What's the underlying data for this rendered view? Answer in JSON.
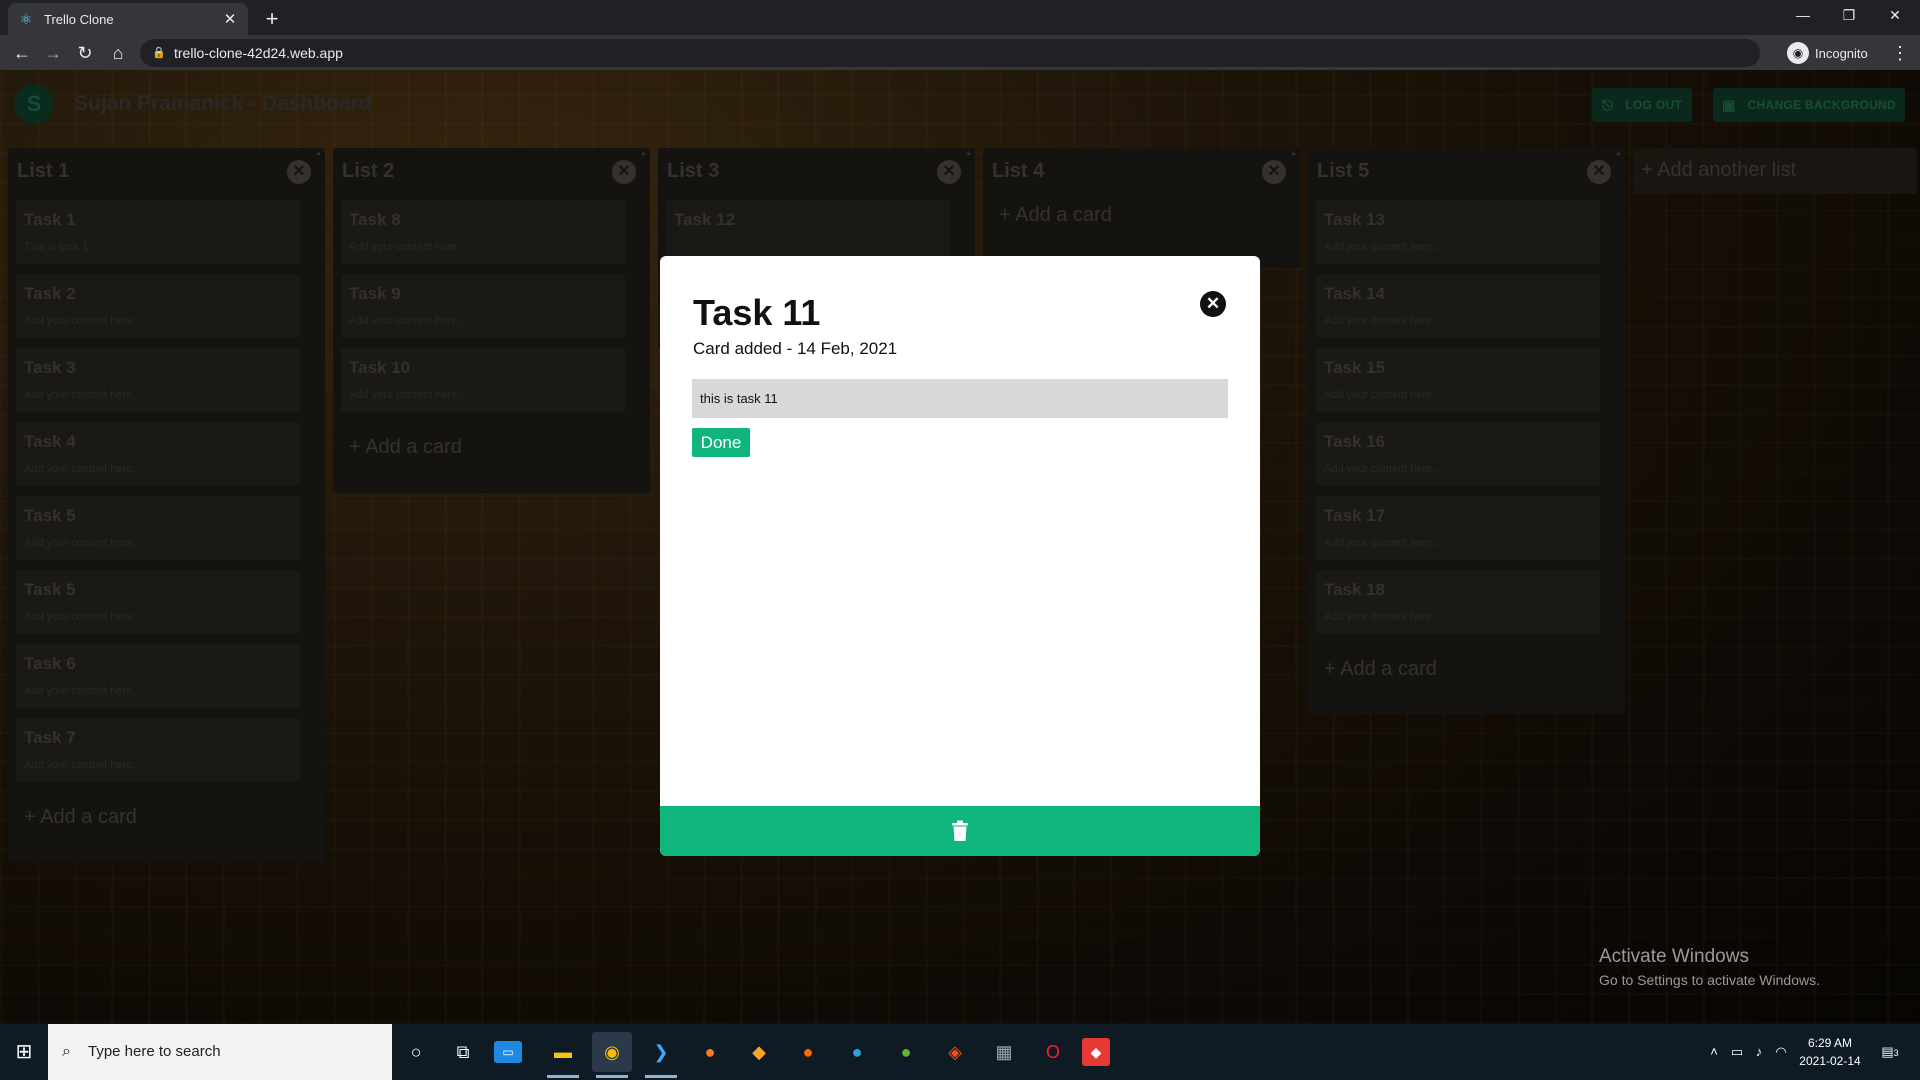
{
  "browser": {
    "tab_title": "Trello Clone",
    "url": "trello-clone-42d24.web.app",
    "profile_label": "Incognito"
  },
  "header": {
    "avatar_letter": "S",
    "title": "Sujan Pramanick - Dashboard",
    "logout_label": "LOG OUT",
    "change_bg_label": "CHANGE BACKGROUND"
  },
  "lists": [
    {
      "title": "List 1",
      "cards": [
        {
          "title": "Task 1",
          "desc": "This is task 1"
        },
        {
          "title": "Task 2",
          "desc": "Add your content here..."
        },
        {
          "title": "Task 3",
          "desc": "Add your content here..."
        },
        {
          "title": "Task 4",
          "desc": "Add your content here..."
        },
        {
          "title": "Task 5",
          "desc": "Add your content here..."
        },
        {
          "title": "Task 5",
          "desc": "Add your content here..."
        },
        {
          "title": "Task 6",
          "desc": "Add your content here..."
        },
        {
          "title": "Task 7",
          "desc": "Add your content here..."
        }
      ],
      "add_label": "+ Add a card"
    },
    {
      "title": "List 2",
      "cards": [
        {
          "title": "Task 8",
          "desc": "Add your content here..."
        },
        {
          "title": "Task 9",
          "desc": "Add your content here..."
        },
        {
          "title": "Task 10",
          "desc": "Add your content here..."
        }
      ],
      "add_label": "+ Add a card"
    },
    {
      "title": "List 3",
      "cards": [
        {
          "title": "Task 12",
          "desc": ""
        }
      ],
      "add_label": ""
    },
    {
      "title": "List 4",
      "cards": [],
      "add_label": "+ Add a card"
    },
    {
      "title": "List 5",
      "cards": [
        {
          "title": "Task 13",
          "desc": "Add your content here..."
        },
        {
          "title": "Task 14",
          "desc": "Add your content here..."
        },
        {
          "title": "Task 15",
          "desc": "Add your content here..."
        },
        {
          "title": "Task 16",
          "desc": "Add your content here..."
        },
        {
          "title": "Task 17",
          "desc": "Add your content here..."
        },
        {
          "title": "Task 18",
          "desc": "Add your content here..."
        }
      ],
      "add_label": "+ Add a card"
    }
  ],
  "add_list_label": "+ Add another list",
  "modal": {
    "title": "Task 11",
    "subtitle": "Card added - 14 Feb, 2021",
    "input_value": "this is task 11",
    "done_label": "Done",
    "close_glyph": "✕"
  },
  "watermark": {
    "line1": "Activate Windows",
    "line2": "Go to Settings to activate Windows."
  },
  "taskbar": {
    "search_placeholder": "Type here to search",
    "time": "6:29 AM",
    "date": "2021-02-14",
    "notification_count": "3"
  },
  "colors": {
    "accent": "#0fb57a",
    "modal_bg": "#ffffff"
  }
}
